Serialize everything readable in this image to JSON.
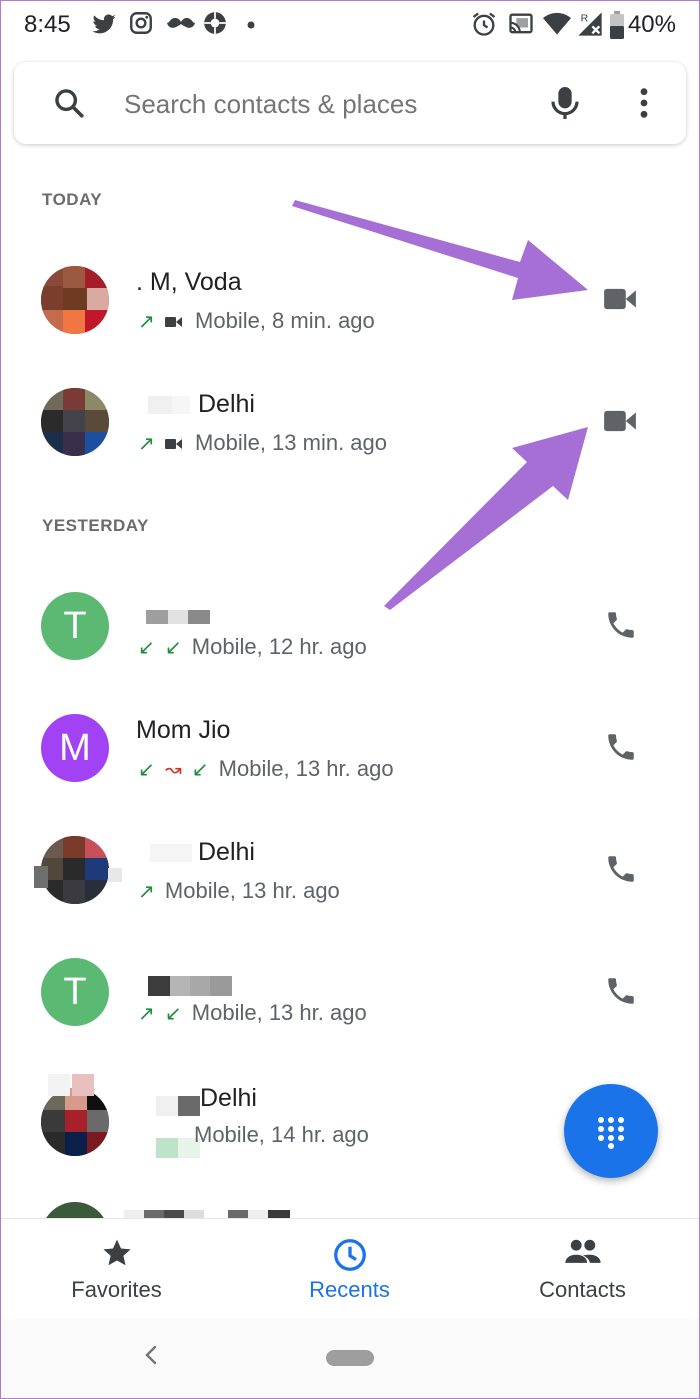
{
  "status_bar": {
    "time": "8:45",
    "battery": "40%"
  },
  "search": {
    "placeholder": "Search contacts & places"
  },
  "sections": {
    "today": "TODAY",
    "yesterday": "YESTERDAY"
  },
  "calls": [
    {
      "name": ". M, Voda",
      "detail": "Mobile, 8 min. ago",
      "arrows": [
        "↗"
      ],
      "video": true,
      "action": "video-call"
    },
    {
      "name": "Delhi",
      "detail": "Mobile, 13 min. ago",
      "arrows": [
        "↗"
      ],
      "video": true,
      "action": "video-call"
    },
    {
      "name": "",
      "avatar_letter": "T",
      "detail": "Mobile, 12 hr. ago",
      "arrows": [
        "↙",
        "↙"
      ],
      "action": "phone-call"
    },
    {
      "name": "Mom Jio",
      "avatar_letter": "M",
      "detail": "Mobile, 13 hr. ago",
      "arrows": [
        "↙",
        "↝",
        "↙"
      ],
      "action": "phone-call"
    },
    {
      "name": "Delhi",
      "detail": "Mobile, 13 hr. ago",
      "arrows": [
        "↗"
      ],
      "action": "phone-call"
    },
    {
      "name": "",
      "avatar_letter": "T",
      "detail": "Mobile, 13 hr. ago",
      "arrows": [
        "↗",
        "↙"
      ],
      "action": "phone-call"
    },
    {
      "name": "Delhi",
      "detail": "Mobile, 14 hr. ago",
      "action": "none"
    }
  ],
  "bottom_nav": {
    "favorites": "Favorites",
    "recents": "Recents",
    "contacts": "Contacts"
  },
  "colors": {
    "accent": "#1a73e8",
    "annotation_arrow": "#a66fd6",
    "avatar_green": "#5bb974",
    "avatar_purple": "#a142f4",
    "outgoing_arrow": "#1e8e3e",
    "missed_arrow": "#d93025"
  },
  "icons": {
    "status": [
      "twitter-icon",
      "instagram-icon",
      "mustache-icon",
      "aperture-icon",
      "alarm-icon",
      "cast-icon",
      "wifi-icon",
      "signal-icon",
      "battery-icon"
    ],
    "row_actions": [
      "video-call-icon",
      "phone-icon"
    ],
    "fab": "dialpad-icon"
  }
}
